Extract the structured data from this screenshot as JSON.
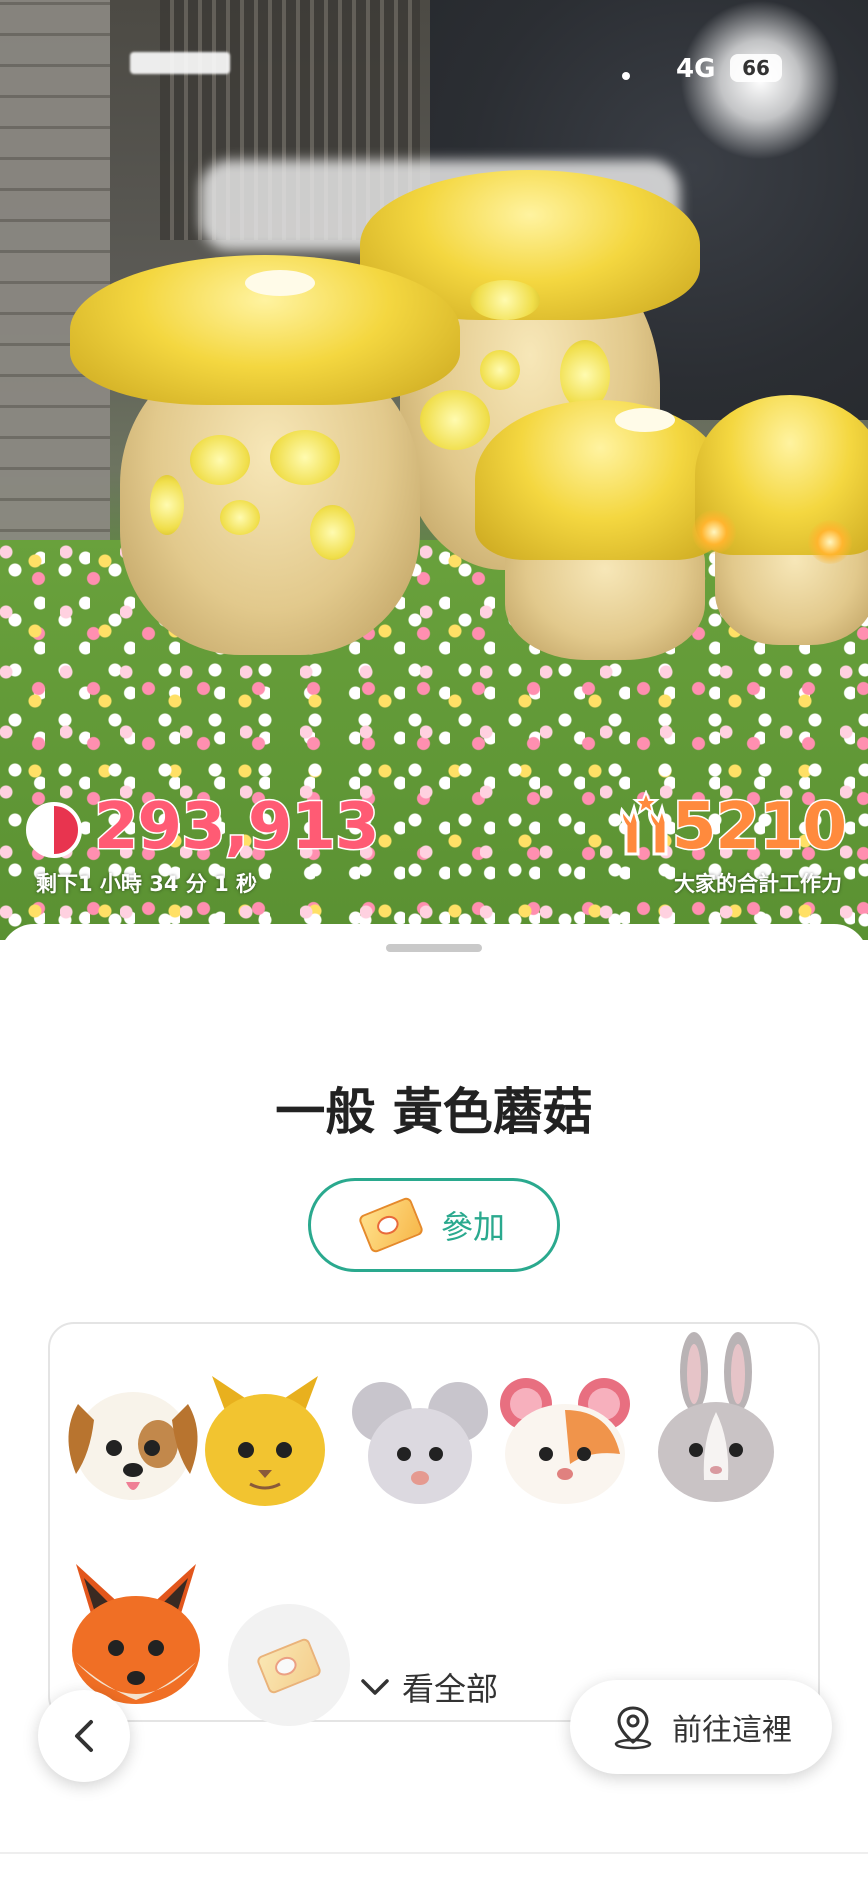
{
  "status_bar": {
    "network": "4G",
    "battery": "66"
  },
  "scene": {
    "hp_value": "293,913",
    "time_remaining": "剩下1 小時 34 分 1 秒",
    "work_value": "5210",
    "work_label": "大家的合計工作力"
  },
  "sheet": {
    "title": "一般 黃色蘑菇",
    "join_label": "參加",
    "see_all_label": "看全部",
    "go_label": "前往這裡"
  },
  "members": [
    "dog",
    "cat",
    "mouse",
    "hamster",
    "rabbit",
    "fox"
  ],
  "colors": {
    "accent": "#2aa98e",
    "hp": "#ff5b74",
    "work": "#ff8a3d"
  }
}
